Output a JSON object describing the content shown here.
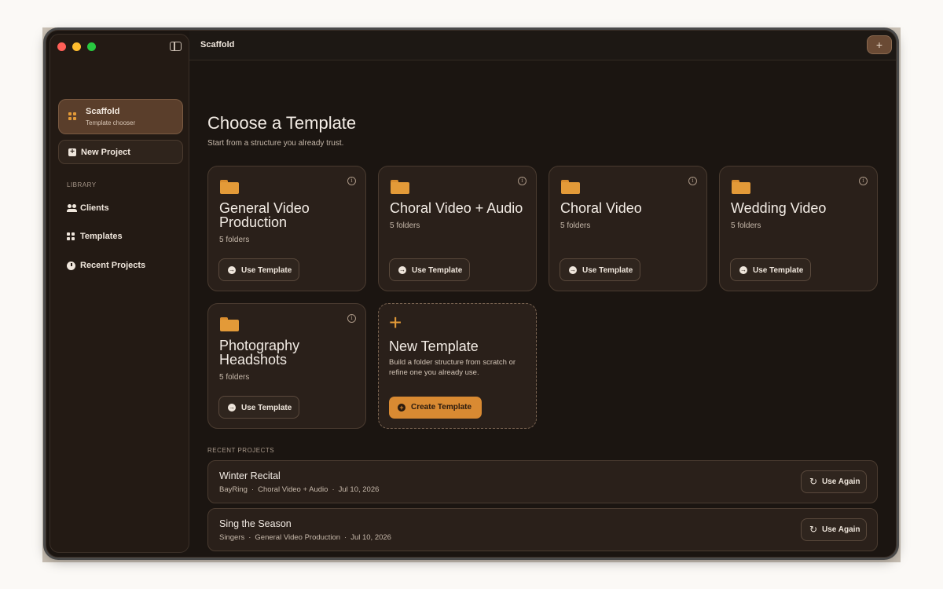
{
  "colors": {
    "accent": "#d98a32",
    "folder": "#e39a38",
    "window_bg": "#1b1511",
    "card_bg": "#2a201a",
    "traffic": [
      "#ff5f57",
      "#febc2e",
      "#28c840"
    ],
    "grid_icon_active": "#e39a38",
    "grid_icon_sidebar": "#efe6dc"
  },
  "header": {
    "title": "Scaffold",
    "add_label": "+"
  },
  "sidebar": {
    "active": {
      "title": "Scaffold",
      "subtitle": "Template chooser",
      "icon": "grid-icon"
    },
    "new_project": {
      "label": "New Project",
      "icon": "plus-square-icon"
    },
    "library_label": "LIBRARY",
    "items": [
      {
        "label": "Clients",
        "icon": "people-icon"
      },
      {
        "label": "Templates",
        "icon": "grid-icon"
      },
      {
        "label": "Recent Projects",
        "icon": "clock-icon"
      }
    ]
  },
  "main": {
    "heading": "Choose a Template",
    "subheading": "Start from a structure you already trust.",
    "use_template_label": "Use Template",
    "templates": [
      {
        "name": "General Video Production",
        "count": "5 folders"
      },
      {
        "name": "Choral Video + Audio",
        "count": "5 folders"
      },
      {
        "name": "Choral Video",
        "count": "5 folders"
      },
      {
        "name": "Wedding Video",
        "count": "5 folders"
      },
      {
        "name": "Photography Headshots",
        "count": "5 folders"
      }
    ],
    "new_template": {
      "plus": "+",
      "title": "New Template",
      "description": "Build a folder structure from scratch or refine one you already use.",
      "button": "Create Template"
    },
    "recent_label": "RECENT PROJECTS",
    "use_again_label": "Use Again",
    "recent": [
      {
        "name": "Winter Recital",
        "client": "BayRing",
        "template": "Choral Video + Audio",
        "date": "Jul 10, 2026"
      },
      {
        "name": "Sing the Season",
        "client": "Singers",
        "template": "General Video Production",
        "date": "Jul 10, 2026"
      }
    ]
  }
}
